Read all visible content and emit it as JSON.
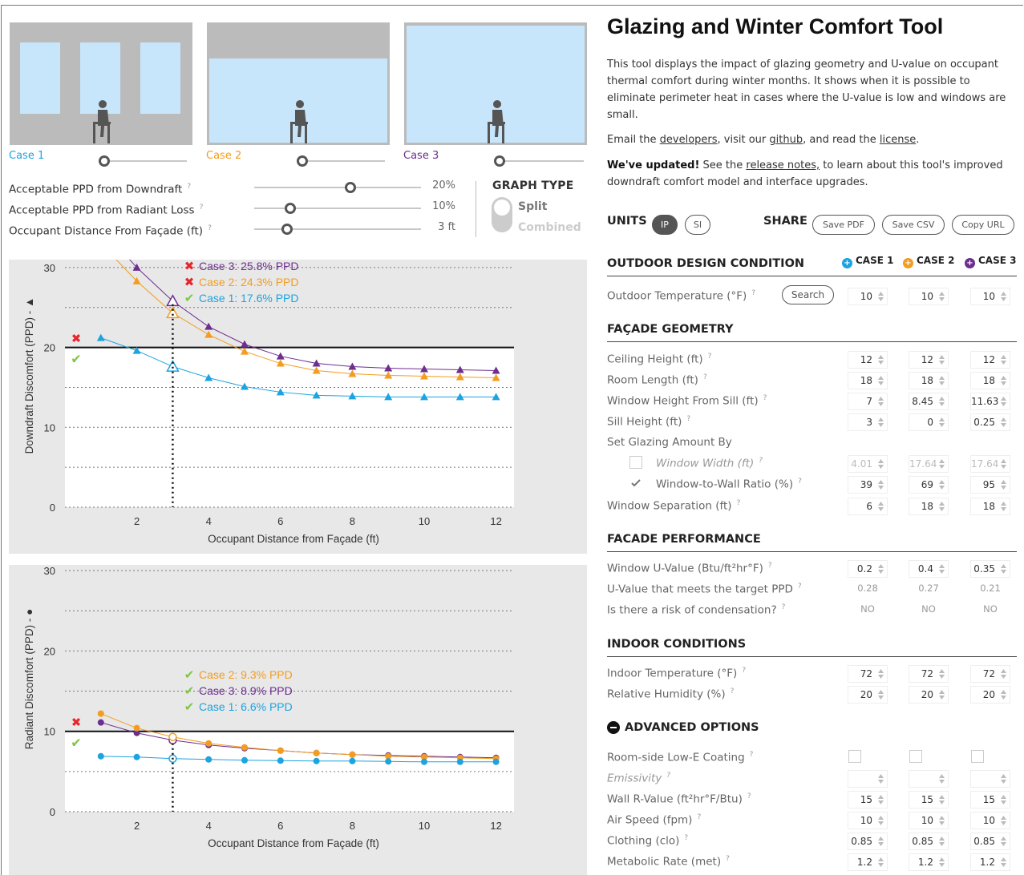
{
  "cases": [
    {
      "label": "Case 1",
      "color": "#1ca3e0"
    },
    {
      "label": "Case 2",
      "color": "#f39c1f"
    },
    {
      "label": "Case 3",
      "color": "#6c2e8f"
    }
  ],
  "controls": {
    "ppd_downdraft": {
      "label": "Acceptable PPD from Downdraft",
      "value": "20%"
    },
    "ppd_radiant": {
      "label": "Acceptable PPD from Radiant Loss",
      "value": "10%"
    },
    "occupant_distance": {
      "label": "Occupant Distance From Façade (ft)",
      "value": "3 ft"
    },
    "graph_type": {
      "title": "GRAPH TYPE",
      "options": [
        "Split",
        "Combined"
      ],
      "selected": "Split"
    }
  },
  "chart_data": [
    {
      "type": "line",
      "ylabel": "Downdraft Discomfort (PPD) - ▲",
      "xlabel": "Occupant Distance from Façade (ft)",
      "xlim": [
        0,
        12.5
      ],
      "ylim": [
        0,
        33
      ],
      "xticks": [
        2,
        4,
        6,
        8,
        10,
        12
      ],
      "yticks": [
        0,
        10,
        20,
        30
      ],
      "threshold": 20,
      "marker_x": 3,
      "marker": "triangle",
      "x": [
        1,
        2,
        3,
        4,
        5,
        6,
        7,
        8,
        9,
        10,
        11,
        12
      ],
      "series": [
        {
          "name": "Case 1",
          "color": "#1ca3e0",
          "values": [
            21.2,
            19.6,
            17.6,
            16.2,
            15.1,
            14.4,
            14.0,
            13.9,
            13.8,
            13.8,
            13.8,
            13.8
          ]
        },
        {
          "name": "Case 2",
          "color": "#f39c1f",
          "values": [
            33.0,
            28.3,
            24.3,
            21.6,
            19.5,
            18.0,
            17.1,
            16.7,
            16.5,
            16.4,
            16.3,
            16.2
          ]
        },
        {
          "name": "Case 3",
          "color": "#6c2e8f",
          "values": [
            35.0,
            30.0,
            25.8,
            22.6,
            20.4,
            18.9,
            18.0,
            17.6,
            17.4,
            17.3,
            17.2,
            17.1
          ]
        }
      ],
      "annotations": [
        "Case 3: 25.8% PPD",
        "Case 2: 24.3% PPD",
        "Case 1: 17.6% PPD"
      ],
      "annotation_marks": [
        "✖",
        "✖",
        "✔"
      ]
    },
    {
      "type": "line",
      "ylabel": "Radiant Discomfort (PPD) - ●",
      "xlabel": "Occupant Distance from Façade (ft)",
      "xlim": [
        0,
        12.5
      ],
      "ylim": [
        0,
        33
      ],
      "xticks": [
        2,
        4,
        6,
        8,
        10,
        12
      ],
      "yticks": [
        0,
        10,
        20,
        30
      ],
      "threshold": 10,
      "marker_x": 3,
      "marker": "circle",
      "x": [
        1,
        2,
        3,
        4,
        5,
        6,
        7,
        8,
        9,
        10,
        11,
        12
      ],
      "series": [
        {
          "name": "Case 1",
          "color": "#1ca3e0",
          "values": [
            6.9,
            6.8,
            6.6,
            6.5,
            6.4,
            6.35,
            6.3,
            6.3,
            6.25,
            6.2,
            6.2,
            6.2
          ]
        },
        {
          "name": "Case 2",
          "color": "#f39c1f",
          "values": [
            12.2,
            10.4,
            9.3,
            8.5,
            8.0,
            7.6,
            7.3,
            7.1,
            6.9,
            6.8,
            6.7,
            6.6
          ]
        },
        {
          "name": "Case 3",
          "color": "#6c2e8f",
          "values": [
            11.1,
            9.8,
            8.9,
            8.3,
            7.9,
            7.6,
            7.3,
            7.1,
            7.0,
            6.9,
            6.8,
            6.7
          ]
        }
      ],
      "annotations": [
        "Case 2: 9.3% PPD",
        "Case 3: 8.9% PPD",
        "Case 1: 6.6% PPD"
      ],
      "annotation_marks": [
        "✔",
        "✔",
        "✔"
      ]
    }
  ],
  "info": {
    "title": "Glazing and Winter Comfort Tool",
    "description": "This tool displays the impact of glazing geometry and U-value on occupant thermal comfort during winter months. It shows when it is possible to eliminate perimeter heat in cases where the U-value is low and windows are small.",
    "email_prefix": "Email the ",
    "developers": "developers",
    "visit": ", visit our ",
    "github": "github",
    "read": ", and read the ",
    "license": "license",
    "end": ".",
    "updated_bold": "We've updated!",
    "updated_see": " See the ",
    "release_notes": "release notes,",
    "updated_rest": " to learn about this tool's improved downdraft comfort model and interface upgrades."
  },
  "units": {
    "label": "UNITS",
    "options": [
      "IP",
      "SI"
    ],
    "selected": "IP"
  },
  "share": {
    "label": "SHARE",
    "buttons": [
      "Save PDF",
      "Save CSV",
      "Copy URL"
    ]
  },
  "sections": {
    "outdoor": "OUTDOOR DESIGN CONDITION",
    "facade_geometry": "FAÇADE GEOMETRY",
    "facade_performance": "FACADE PERFORMANCE",
    "indoor": "INDOOR CONDITIONS",
    "advanced": "ADVANCED OPTIONS"
  },
  "legend": [
    "CASE 1",
    "CASE 2",
    "CASE 3"
  ],
  "search_label": "Search",
  "rows": {
    "outdoor_temp": {
      "label": "Outdoor Temperature (°F)",
      "values": [
        "10",
        "10",
        "10"
      ]
    },
    "ceiling_height": {
      "label": "Ceiling Height (ft)",
      "values": [
        "12",
        "12",
        "12"
      ]
    },
    "room_length": {
      "label": "Room Length (ft)",
      "values": [
        "18",
        "18",
        "18"
      ]
    },
    "window_height": {
      "label": "Window Height From Sill (ft)",
      "values": [
        "7",
        "8.45",
        "11.63"
      ]
    },
    "sill_height": {
      "label": "Sill Height (ft)",
      "values": [
        "3",
        "0",
        "0.25"
      ]
    },
    "set_glazing": {
      "label": "Set Glazing Amount By"
    },
    "window_width": {
      "label": "Window Width (ft)",
      "values": [
        "4.01",
        "17.64",
        "17.64"
      ]
    },
    "wwr": {
      "label": "Window-to-Wall Ratio (%)",
      "values": [
        "39",
        "69",
        "95"
      ]
    },
    "window_sep": {
      "label": "Window Separation (ft)",
      "values": [
        "6",
        "18",
        "18"
      ]
    },
    "u_value": {
      "label": "Window U-Value (Btu/ft²hr°F)",
      "values": [
        "0.2",
        "0.4",
        "0.35"
      ]
    },
    "u_target": {
      "label": "U-Value that meets the target PPD",
      "values": [
        "0.28",
        "0.27",
        "0.21"
      ]
    },
    "condensation": {
      "label": "Is there a risk of condensation?",
      "values": [
        "NO",
        "NO",
        "NO"
      ]
    },
    "indoor_temp": {
      "label": "Indoor Temperature (°F)",
      "values": [
        "72",
        "72",
        "72"
      ]
    },
    "humidity": {
      "label": "Relative Humidity (%)",
      "values": [
        "20",
        "20",
        "20"
      ]
    },
    "lowe": {
      "label": "Room-side Low-E Coating"
    },
    "emissivity": {
      "label": "Emissivity",
      "values": [
        "",
        "",
        ""
      ]
    },
    "wall_r": {
      "label": "Wall R-Value (ft²hr°F/Btu)",
      "values": [
        "15",
        "15",
        "15"
      ]
    },
    "air_speed": {
      "label": "Air Speed (fpm)",
      "values": [
        "10",
        "10",
        "10"
      ]
    },
    "clothing": {
      "label": "Clothing (clo)",
      "values": [
        "0.85",
        "0.85",
        "0.85"
      ]
    },
    "metabolic": {
      "label": "Metabolic Rate (met)",
      "values": [
        "1.2",
        "1.2",
        "1.2"
      ]
    }
  }
}
